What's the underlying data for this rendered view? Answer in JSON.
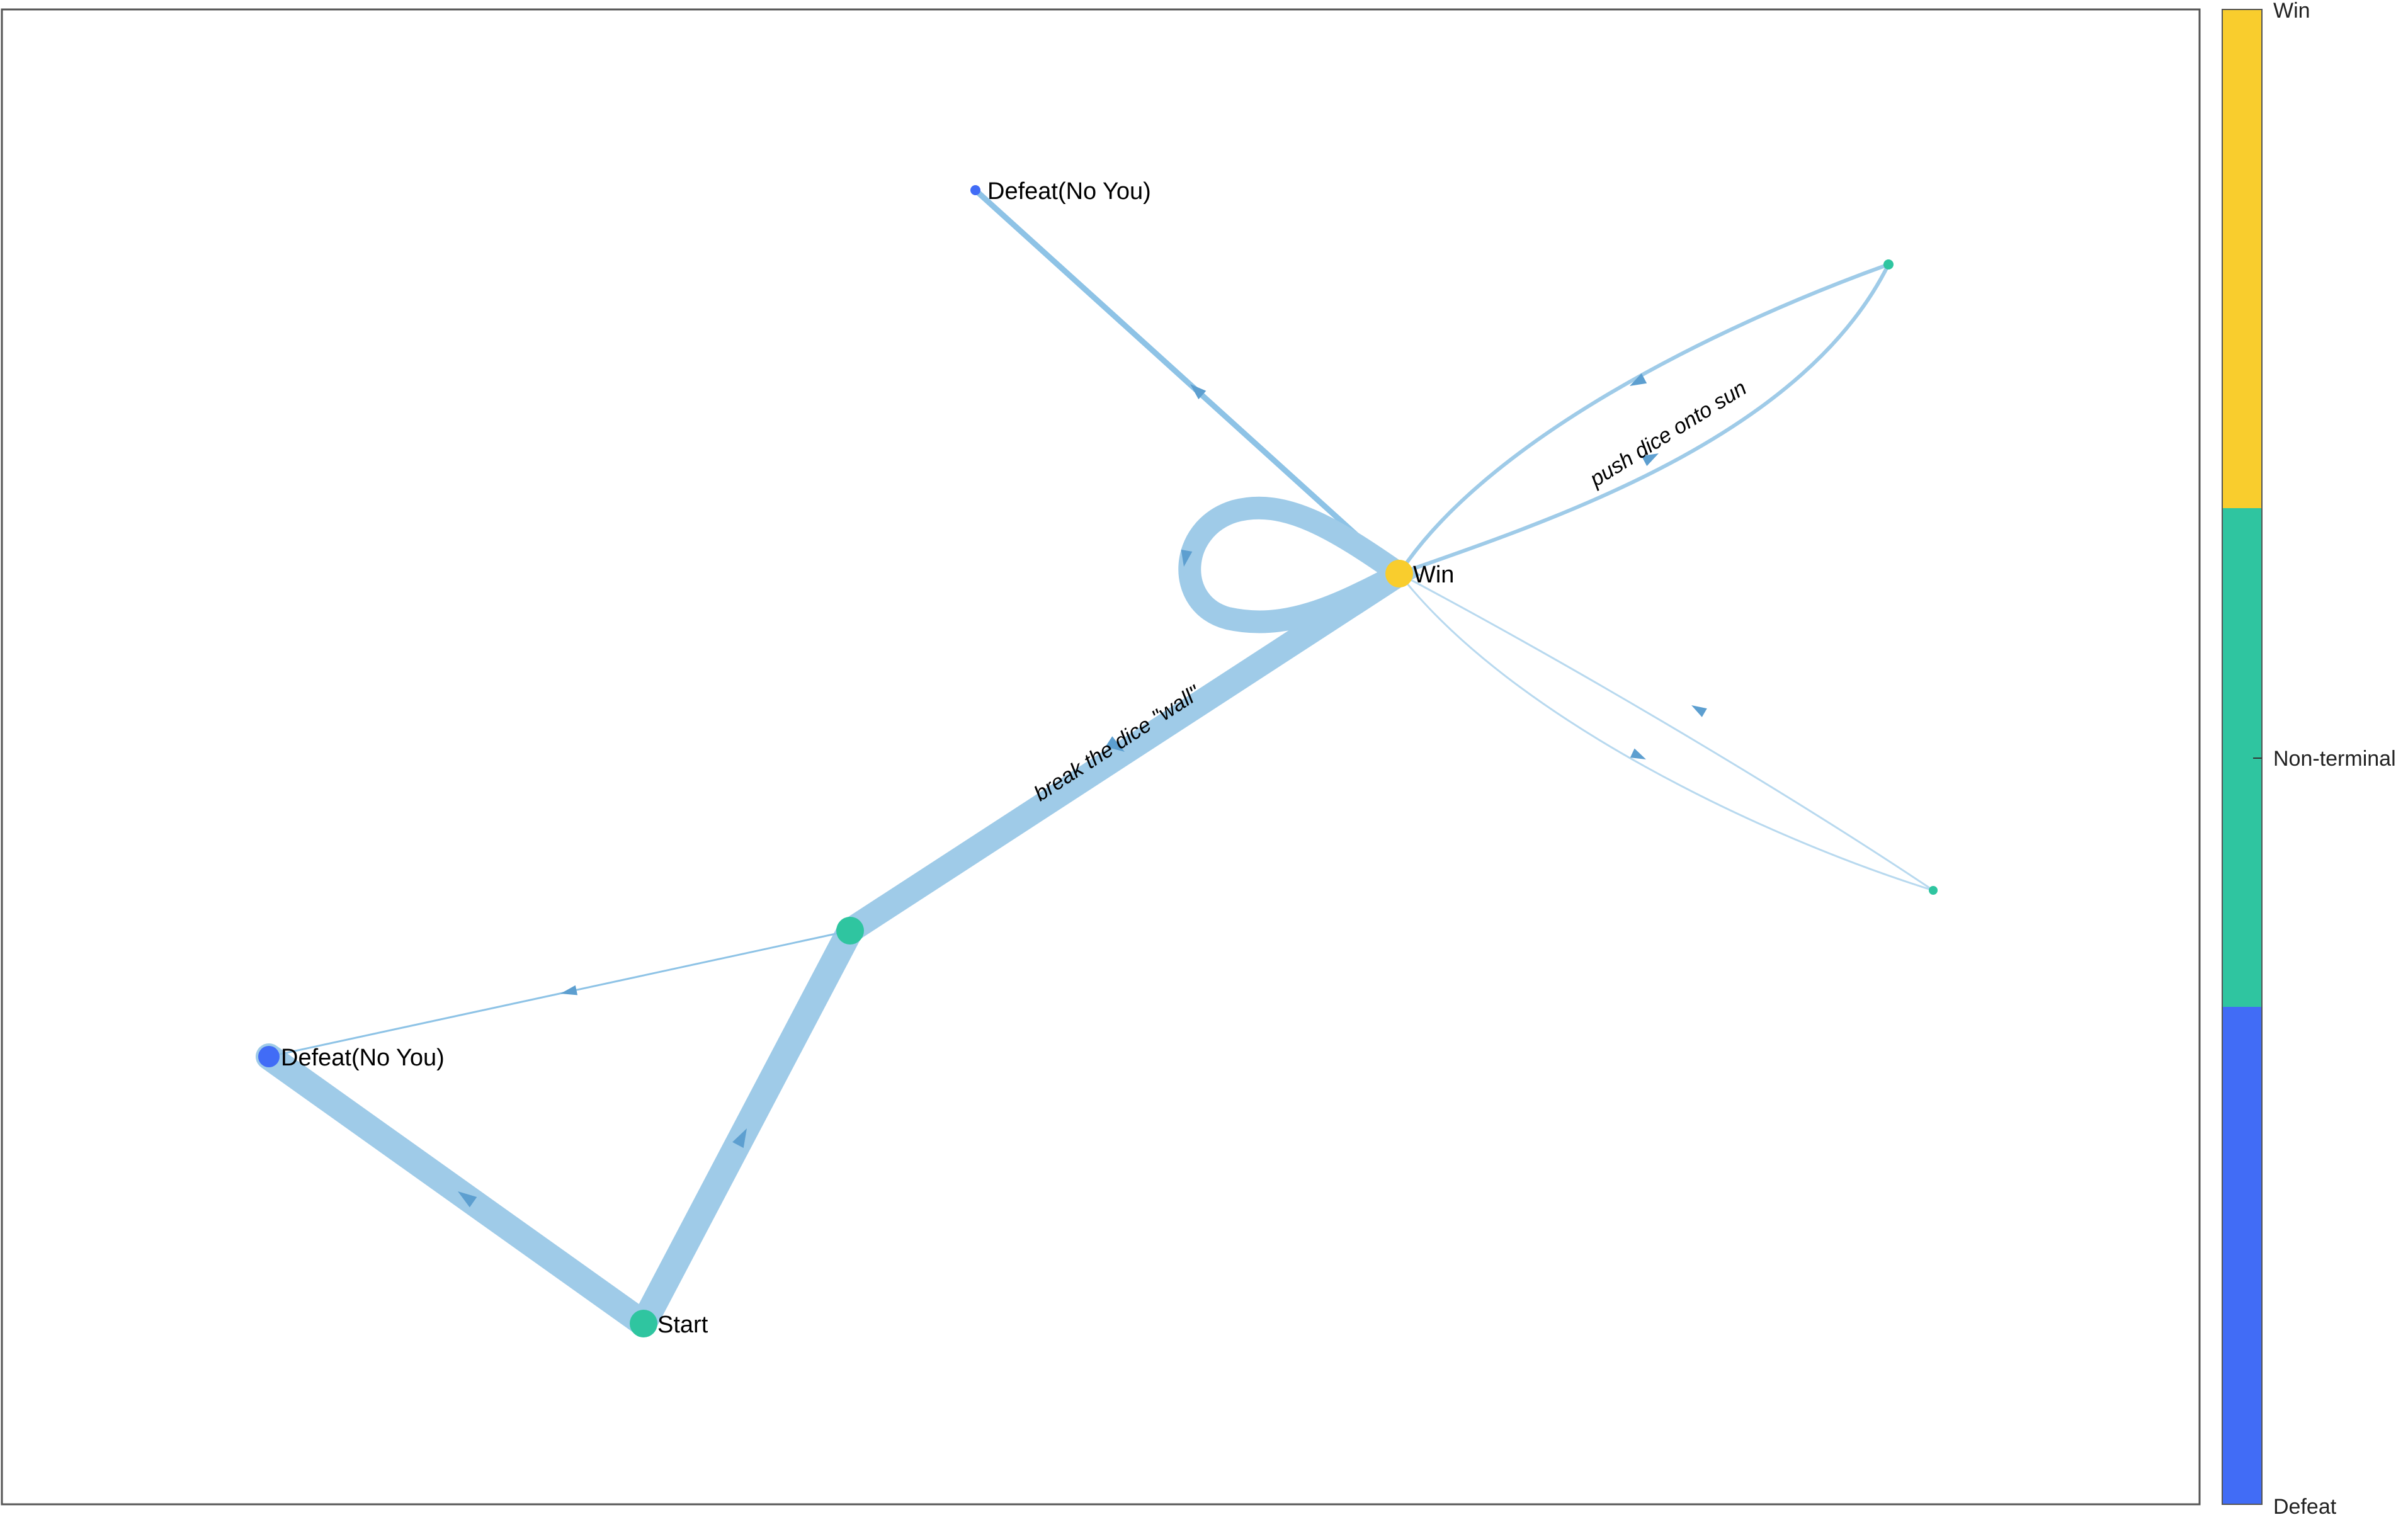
{
  "colors": {
    "win": "#f9cd2d",
    "non_terminal": "#2fc5a0",
    "defeat": "#416cf6",
    "edge": "#9fcbe8",
    "edge_arrow": "#5d9fd0",
    "frame": "#555555"
  },
  "nodes": {
    "start": {
      "label": "Start",
      "kind": "non_terminal"
    },
    "mid": {
      "label": "",
      "kind": "non_terminal"
    },
    "win": {
      "label": "Win",
      "kind": "win"
    },
    "defeat_left": {
      "label": "Defeat(No You)",
      "kind": "defeat"
    },
    "defeat_top": {
      "label": "Defeat(No You)",
      "kind": "defeat"
    },
    "nt_upper_right": {
      "label": "",
      "kind": "non_terminal"
    },
    "nt_lower_right": {
      "label": "",
      "kind": "non_terminal"
    }
  },
  "edges": {
    "mid_to_win": {
      "label": "break the dice \"wall\""
    },
    "win_to_upper_right": {
      "label": "push dice onto sun"
    }
  },
  "colorbar": {
    "ticks": [
      "Win",
      "Non-terminal",
      "Defeat"
    ],
    "order_top_to_bottom": [
      "win",
      "non_terminal",
      "defeat"
    ]
  }
}
